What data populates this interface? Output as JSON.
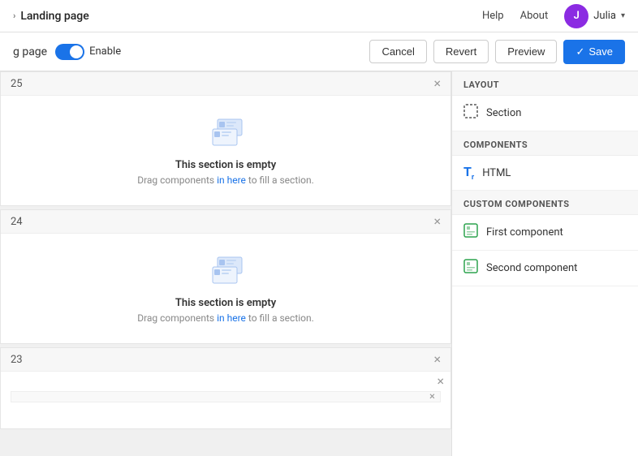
{
  "nav": {
    "title": "Landing page",
    "help": "Help",
    "about": "About",
    "user_initial": "J",
    "user_name": "Julia",
    "dropdown_symbol": "▾",
    "chevron": "›"
  },
  "toolbar": {
    "page_label": "g page",
    "enable_label": "Enable",
    "cancel_label": "Cancel",
    "revert_label": "Revert",
    "preview_label": "Preview",
    "save_label": "Save",
    "check_symbol": "✓"
  },
  "sections": [
    {
      "id": "25",
      "empty_title": "This section is empty",
      "empty_desc_pre": "Drag components ",
      "empty_desc_link": "in here",
      "empty_desc_post": " to fill a section."
    },
    {
      "id": "24",
      "empty_title": "This section is empty",
      "empty_desc_pre": "Drag components ",
      "empty_desc_link": "in here",
      "empty_desc_post": " to fill a section."
    }
  ],
  "section_23": {
    "id": "23"
  },
  "sidebar": {
    "layout_title": "LAYOUT",
    "components_title": "COMPONENTS",
    "custom_title": "CUSTOM COMPONENTS",
    "layout_items": [
      {
        "label": "Section",
        "icon": "section"
      }
    ],
    "component_items": [
      {
        "label": "HTML",
        "icon": "html"
      }
    ],
    "custom_items": [
      {
        "label": "First component",
        "icon": "custom"
      },
      {
        "label": "Second component",
        "icon": "custom"
      }
    ]
  }
}
